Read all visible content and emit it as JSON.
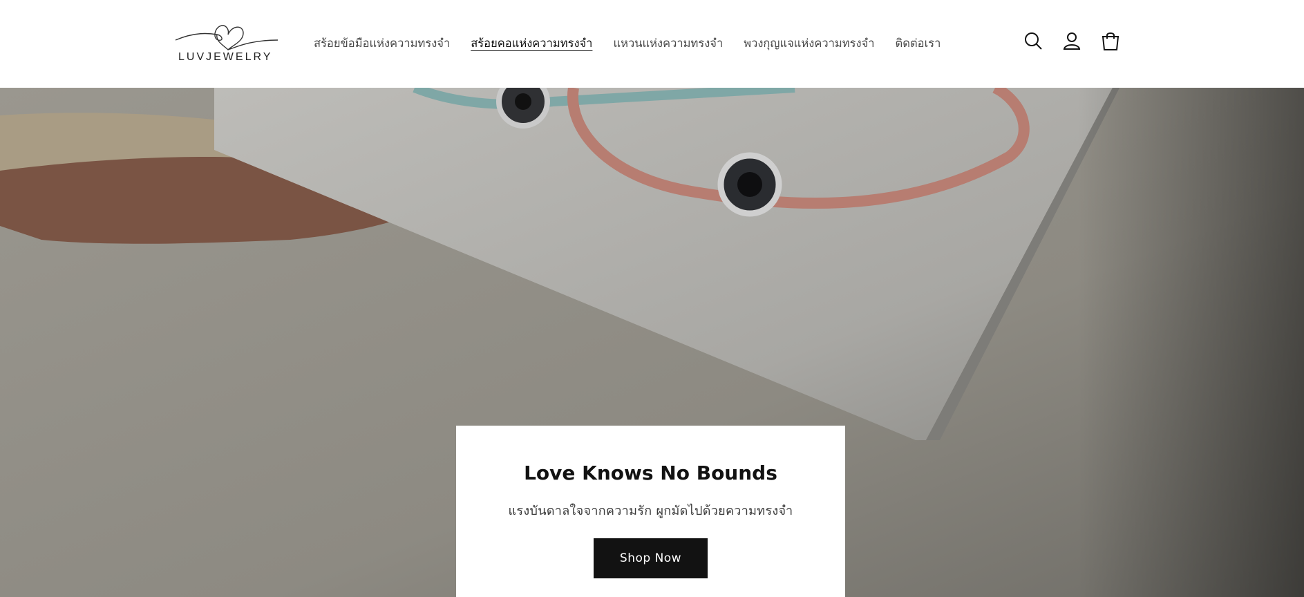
{
  "brand": {
    "logo_text": "LUVJEWELRY"
  },
  "nav": {
    "items": [
      {
        "label": "สร้อยข้อมือแห่งความทรงจำ",
        "active": false
      },
      {
        "label": "สร้อยคอแห่งความทรงจำ",
        "active": true
      },
      {
        "label": "แหวนแห่งความทรงจำ",
        "active": false
      },
      {
        "label": "พวงกุญแจแห่งความทรงจำ",
        "active": false
      },
      {
        "label": "ติดต่อเรา",
        "active": false
      }
    ]
  },
  "header_icons": [
    "search-icon",
    "account-icon",
    "cart-icon"
  ],
  "hero": {
    "title": "Love Knows No Bounds",
    "subtitle": "แรงบันดาลใจจากความรัก ผูกมัดไปด้วยความทรงจำ",
    "button_label": "Shop Now"
  },
  "colors": {
    "header_bg": "#ffffff",
    "button_bg": "#121212",
    "button_text": "#ffffff",
    "text_dark": "#121212"
  }
}
